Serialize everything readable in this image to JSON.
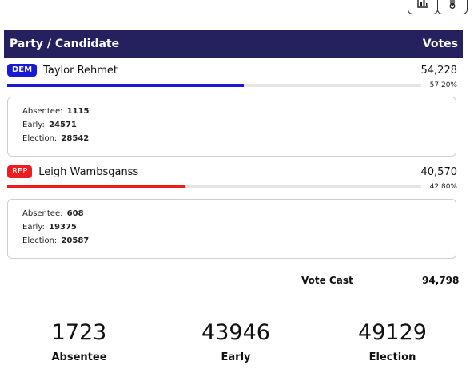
{
  "toolbar": {
    "chart_icon": "bar-chart-icon",
    "thermometer_icon": "thermometer-icon"
  },
  "table": {
    "col_party_candidate": "Party / Candidate",
    "col_votes": "Votes"
  },
  "colors": {
    "header_bg": "#24215e",
    "dem": "#1a1ad6",
    "rep": "#ee1c1c"
  },
  "candidates": [
    {
      "party": "DEM",
      "name": "Taylor Rehmet",
      "votes": "54,228",
      "percent": "57.20%",
      "share": 0.572,
      "absentee_label": "Absentee:",
      "absentee": "1115",
      "early_label": "Early:",
      "early": "24571",
      "election_label": "Election:",
      "election": "28542"
    },
    {
      "party": "REP",
      "name": "Leigh Wambsganss",
      "votes": "40,570",
      "percent": "42.80%",
      "share": 0.428,
      "absentee_label": "Absentee:",
      "absentee": "608",
      "early_label": "Early:",
      "early": "19375",
      "election_label": "Election:",
      "election": "20587"
    }
  ],
  "totals": {
    "vote_cast_label": "Vote Cast",
    "vote_cast": "94,798"
  },
  "summary": [
    {
      "value": "1723",
      "label": "Absentee"
    },
    {
      "value": "43946",
      "label": "Early"
    },
    {
      "value": "49129",
      "label": "Election"
    }
  ]
}
